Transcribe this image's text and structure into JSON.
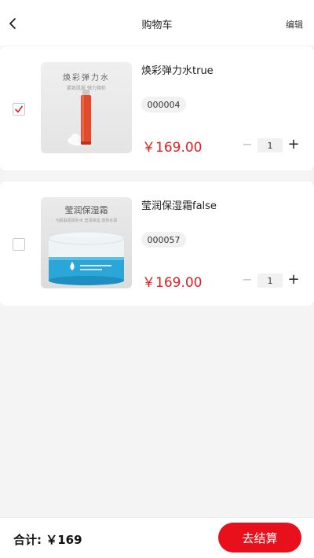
{
  "header": {
    "title": "购物车",
    "edit_label": "编辑",
    "back_icon": "chevron-left-icon"
  },
  "items": [
    {
      "name": "焕彩弹力水true",
      "code": "000004",
      "price": "￥169.00",
      "quantity": "1",
      "checked": true,
      "image_title": "焕彩弹力水",
      "image_subtitle": "紧致肌肤 弹力焕彩"
    },
    {
      "name": "莹润保湿霜false",
      "code": "000057",
      "price": "￥169.00",
      "quantity": "1",
      "checked": false,
      "image_title": "莹润保湿霜",
      "image_subtitle": "为肌肤源源补水 莹润保湿 透亮水润"
    }
  ],
  "stepper": {
    "minus_label": "−",
    "plus_label": "+"
  },
  "footer": {
    "total": "合计: ￥169",
    "checkout_label": "去结算"
  },
  "colors": {
    "accent": "#e8101b",
    "price": "#e02020",
    "background": "#f4f4f4"
  }
}
